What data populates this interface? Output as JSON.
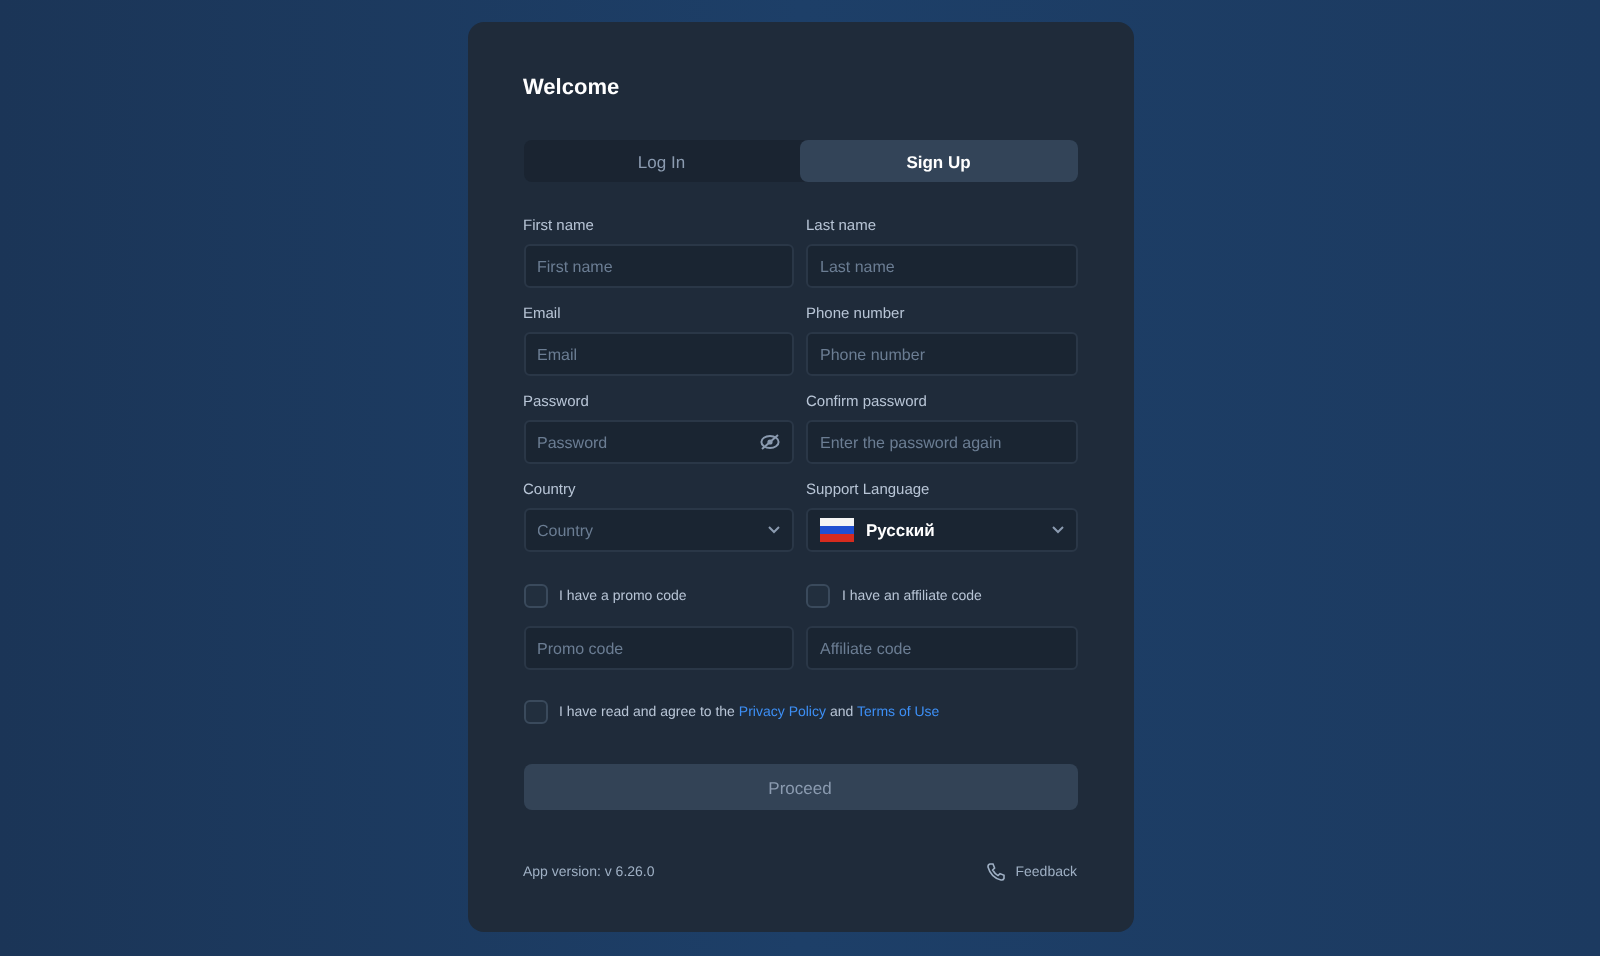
{
  "title": "Welcome",
  "tabs": [
    {
      "label": "Log In",
      "selected": false
    },
    {
      "label": "Sign Up",
      "selected": true
    }
  ],
  "fields": [
    {
      "kind": "text",
      "label": "First name",
      "placeholder": "First name"
    },
    {
      "kind": "text",
      "label": "Last name",
      "placeholder": "Last name"
    },
    {
      "kind": "text",
      "label": "Email",
      "placeholder": "Email"
    },
    {
      "kind": "text",
      "label": "Phone number",
      "placeholder": "Phone number"
    },
    {
      "kind": "password",
      "label": "Password",
      "placeholder": "Password"
    },
    {
      "kind": "text",
      "label": "Confirm password",
      "placeholder": "Enter the password again"
    },
    {
      "kind": "select",
      "label": "Country",
      "placeholder": "Country"
    },
    {
      "kind": "language",
      "label": "Support Language",
      "value": "Русский"
    }
  ],
  "codes": [
    {
      "label": "I have a promo code",
      "checked": false,
      "placeholder": "Promo code"
    },
    {
      "label": "I have an affiliate code",
      "checked": false,
      "placeholder": "Affiliate code"
    }
  ],
  "agreement": {
    "checked": false,
    "text": "I have read and agree to the",
    "link1": "Privacy Policy",
    "middle": "and",
    "link2": "Terms of Use"
  },
  "submit": {
    "label": "Proceed",
    "disabled": true
  },
  "footer": {
    "version": "App version: v 6.26.0",
    "feedback": "Feedback"
  }
}
